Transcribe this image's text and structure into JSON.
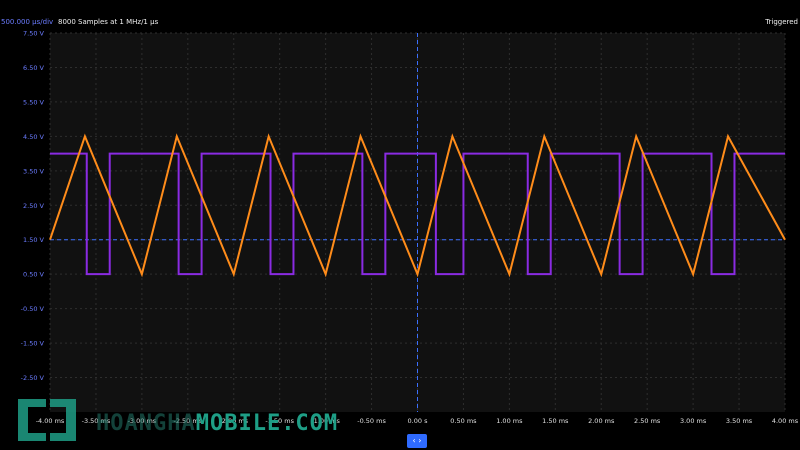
{
  "header": {
    "timebase": "500.000 µs/div",
    "samples": "8000 Samples at 1 MHz/1 µs",
    "status": "Triggered"
  },
  "footer": {
    "scroll_glyph": "‹ ›"
  },
  "watermark": {
    "text_dark": "HOANGHA",
    "text_bright": "MOBILE.COM"
  },
  "colors": {
    "background": "#111111",
    "grid": "#2e2e2e",
    "axis_labels": "#6b7cff",
    "channel_1": "#8a2be2",
    "channel_2": "#ff8c1a",
    "cursor": "#3b6fff"
  },
  "chart_data": {
    "type": "line",
    "title": "",
    "xlabel": "",
    "ylabel": "",
    "grid": true,
    "xlim": [
      -4.0,
      4.0
    ],
    "ylim": [
      -3.5,
      7.5
    ],
    "x_ticks": [
      "-4.00 ms",
      "-3.50 ms",
      "-3.00 ms",
      "-2.50 ms",
      "-2.00 ms",
      "-1.50 ms",
      "-1.00 ms",
      "-0.50 ms",
      "0.00 s",
      "0.50 ms",
      "1.00 ms",
      "1.50 ms",
      "2.00 ms",
      "2.50 ms",
      "3.00 ms",
      "3.50 ms",
      "4.00 ms"
    ],
    "y_ticks": [
      "7.50 V",
      "6.50 V",
      "5.50 V",
      "4.50 V",
      "3.50 V",
      "2.50 V",
      "1.50 V",
      "0.50 V",
      "-0.50 V",
      "-1.50 V",
      "-2.50 V"
    ],
    "trigger_level": 1.5,
    "series": [
      {
        "name": "",
        "color": "#8a2be2",
        "kind": "square",
        "high": 4.0,
        "low": 0.5,
        "high_intervals": [
          [
            -4.0,
            -3.6
          ],
          [
            -3.35,
            -2.6
          ],
          [
            -2.35,
            -1.6
          ],
          [
            -1.35,
            -0.6
          ],
          [
            -0.35,
            0.2
          ],
          [
            0.5,
            1.2
          ],
          [
            1.45,
            2.2
          ],
          [
            2.45,
            3.2
          ],
          [
            3.45,
            4.0
          ]
        ]
      },
      {
        "name": "",
        "color": "#ff8c1a",
        "kind": "triangle",
        "points": [
          [
            -4.0,
            1.5
          ],
          [
            -3.62,
            4.5
          ],
          [
            -3.0,
            0.5
          ],
          [
            -2.62,
            4.5
          ],
          [
            -2.0,
            0.5
          ],
          [
            -1.62,
            4.5
          ],
          [
            -1.0,
            0.5
          ],
          [
            -0.62,
            4.5
          ],
          [
            0.0,
            0.5
          ],
          [
            0.38,
            4.5
          ],
          [
            1.0,
            0.5
          ],
          [
            1.38,
            4.5
          ],
          [
            2.0,
            0.5
          ],
          [
            2.38,
            4.5
          ],
          [
            3.0,
            0.5
          ],
          [
            3.38,
            4.5
          ],
          [
            4.0,
            1.5
          ]
        ]
      }
    ]
  }
}
